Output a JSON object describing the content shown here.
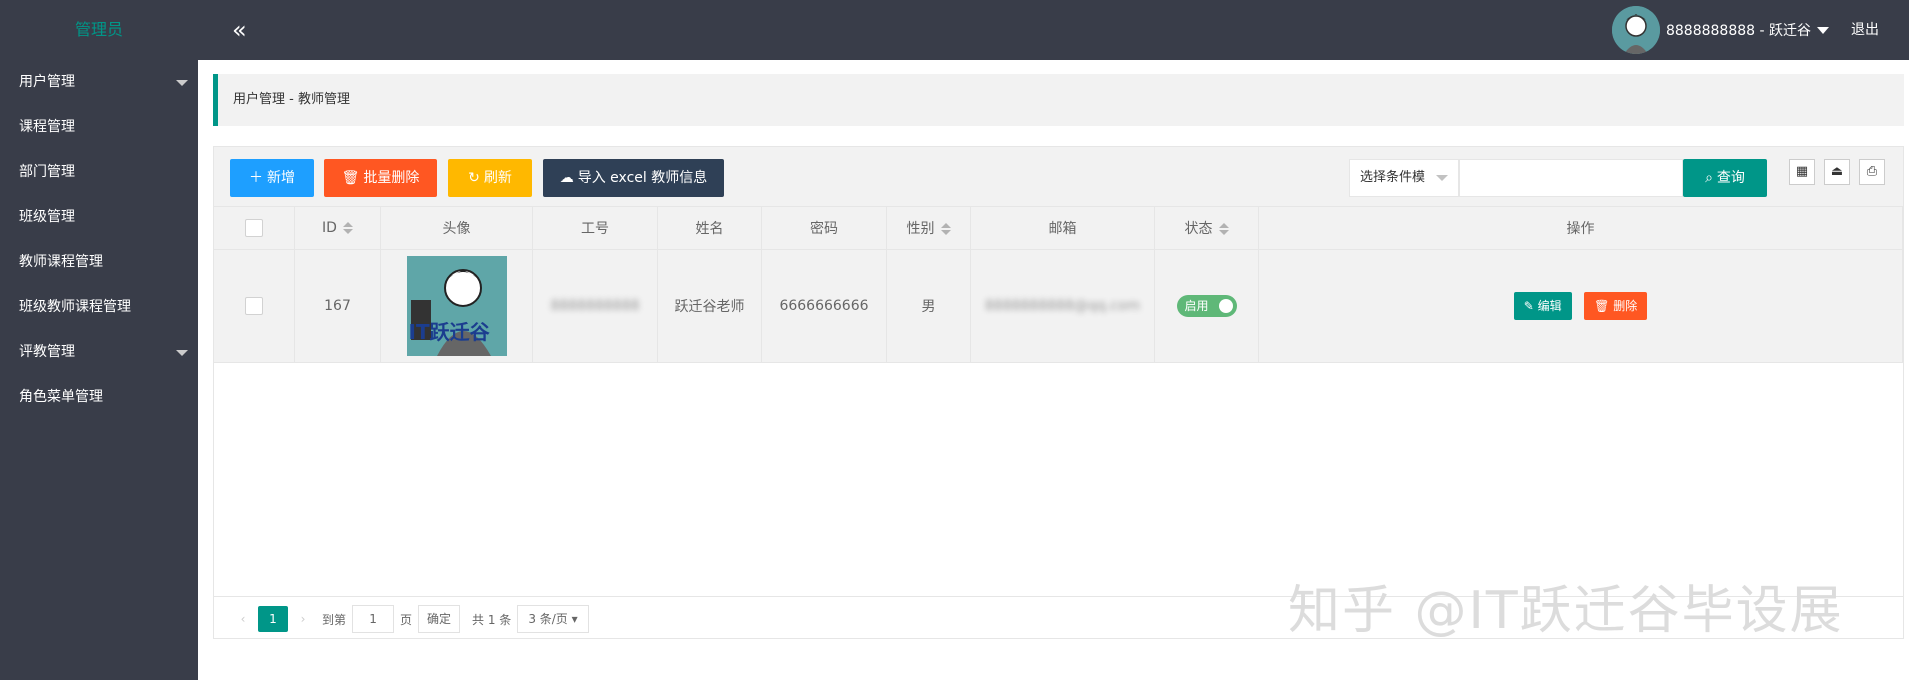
{
  "header": {
    "logo": "管理员",
    "collapse_icon": "«",
    "user_label": "8888888888 - 跃迁谷",
    "logout": "退出"
  },
  "sidebar": {
    "items": [
      {
        "label": "用户管理"
      },
      {
        "label": "课程管理"
      },
      {
        "label": "部门管理"
      },
      {
        "label": "班级管理"
      },
      {
        "label": "教师课程管理"
      },
      {
        "label": "班级教师课程管理"
      },
      {
        "label": "评教管理"
      },
      {
        "label": "角色菜单管理"
      }
    ]
  },
  "breadcrumb": "用户管理 - 教师管理",
  "toolbar": {
    "add": "新增",
    "batch_delete": "批量删除",
    "refresh": "刷新",
    "import": "导入 excel 教师信息",
    "condition_placeholder": "选择条件模",
    "search": "查询"
  },
  "table": {
    "headers": [
      "ID",
      "头像",
      "工号",
      "姓名",
      "密码",
      "性别",
      "邮箱",
      "状态",
      "操作"
    ],
    "row": {
      "id": "167",
      "avatar_text": "IT跃迁谷",
      "job_no": "8888888888",
      "name": "跃迁谷老师",
      "password": "6666666666",
      "gender": "男",
      "email": "8888888888@qq.com",
      "status": "启用",
      "edit": "编辑",
      "delete": "删除"
    }
  },
  "pager": {
    "current": "1",
    "goto": "到第",
    "page_input": "1",
    "page_unit": "页",
    "confirm": "确定",
    "total": "共 1 条",
    "per_page": "3 条/页"
  },
  "watermark": "知乎 @IT跃迁谷毕设展",
  "colors": {
    "sidebar": "#393d49",
    "accent": "#009688",
    "blue": "#1e9fff",
    "orange": "#ff5722",
    "yellow": "#ffb800",
    "dark": "#2f4056"
  }
}
